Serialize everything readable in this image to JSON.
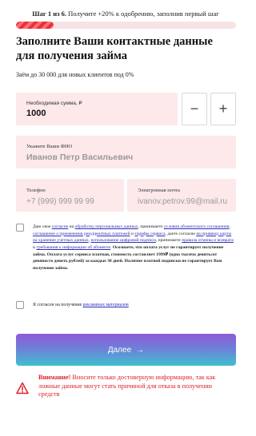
{
  "header": {
    "step_label": "Шаг 1 из 6.",
    "step_hint": "Получите +20% к одобрению, заполнив первый шаг",
    "progress": 0.17
  },
  "title": "Заполните Ваши контактные данные для получения займа",
  "subtitle": "Заём до 30 000 для новых клиентов под 0%",
  "amount": {
    "label": "Необходимая сумма, ₽",
    "value": "1000",
    "minus": "−",
    "plus": "+"
  },
  "fio": {
    "label": "Укажите Ваши ФИО",
    "placeholder": "Иванов Петр Васильевич"
  },
  "phone": {
    "label": "Телефон",
    "placeholder": "+7 (999) 999 99 99"
  },
  "email": {
    "label": "Электронная почта",
    "placeholder": "ivanov.petrov.99@mail.ru"
  },
  "consent": {
    "t1": "Даю свое ",
    "l1": "согласие",
    "t2": " на ",
    "l2": "обработку персональных данных",
    "t3": ", принимаете ",
    "l3": "условия абонентского соглашения",
    "t4": ", ",
    "l4": "соглашение о применении рекуррентных платежей",
    "t5": " и ",
    "l5": "тарифы сервиса",
    "t6": ", даете согласие ",
    "l6": "на привязку карты на хранение учетных данных",
    "t7": ", ",
    "l7": "использование цифровой подписи",
    "t8": ", принимаете ",
    "l8": "правила отмены и возврата",
    "t9": " и ",
    "l9": "требования к информации об абоненте",
    "t10": ". ",
    "bold": "Осознаете, что оплата услуг не гарантирует получение займа. Оплата услуг сервиса платная, стоимость составляет 1999₽ (одна тысяча девятьсот девяносто девять рублей) за каждые 30 дней. Наличие платной подписки не гарантирует Вам получение займа."
  },
  "marketing": {
    "text": "Я согласен на получение ",
    "link": "рекламных материалов"
  },
  "next_button": {
    "label": "Далее",
    "arrow": "→"
  },
  "warning": {
    "strong": "Внимание!",
    "text": " Вносите только достоверную информацию, так как ложные данные могут стать причиной для отказа в получении средств"
  },
  "colors": {
    "accent": "#e7303a",
    "field_bg": "#fde8ea",
    "link": "#2d2db8",
    "warning": "#e0202a"
  }
}
